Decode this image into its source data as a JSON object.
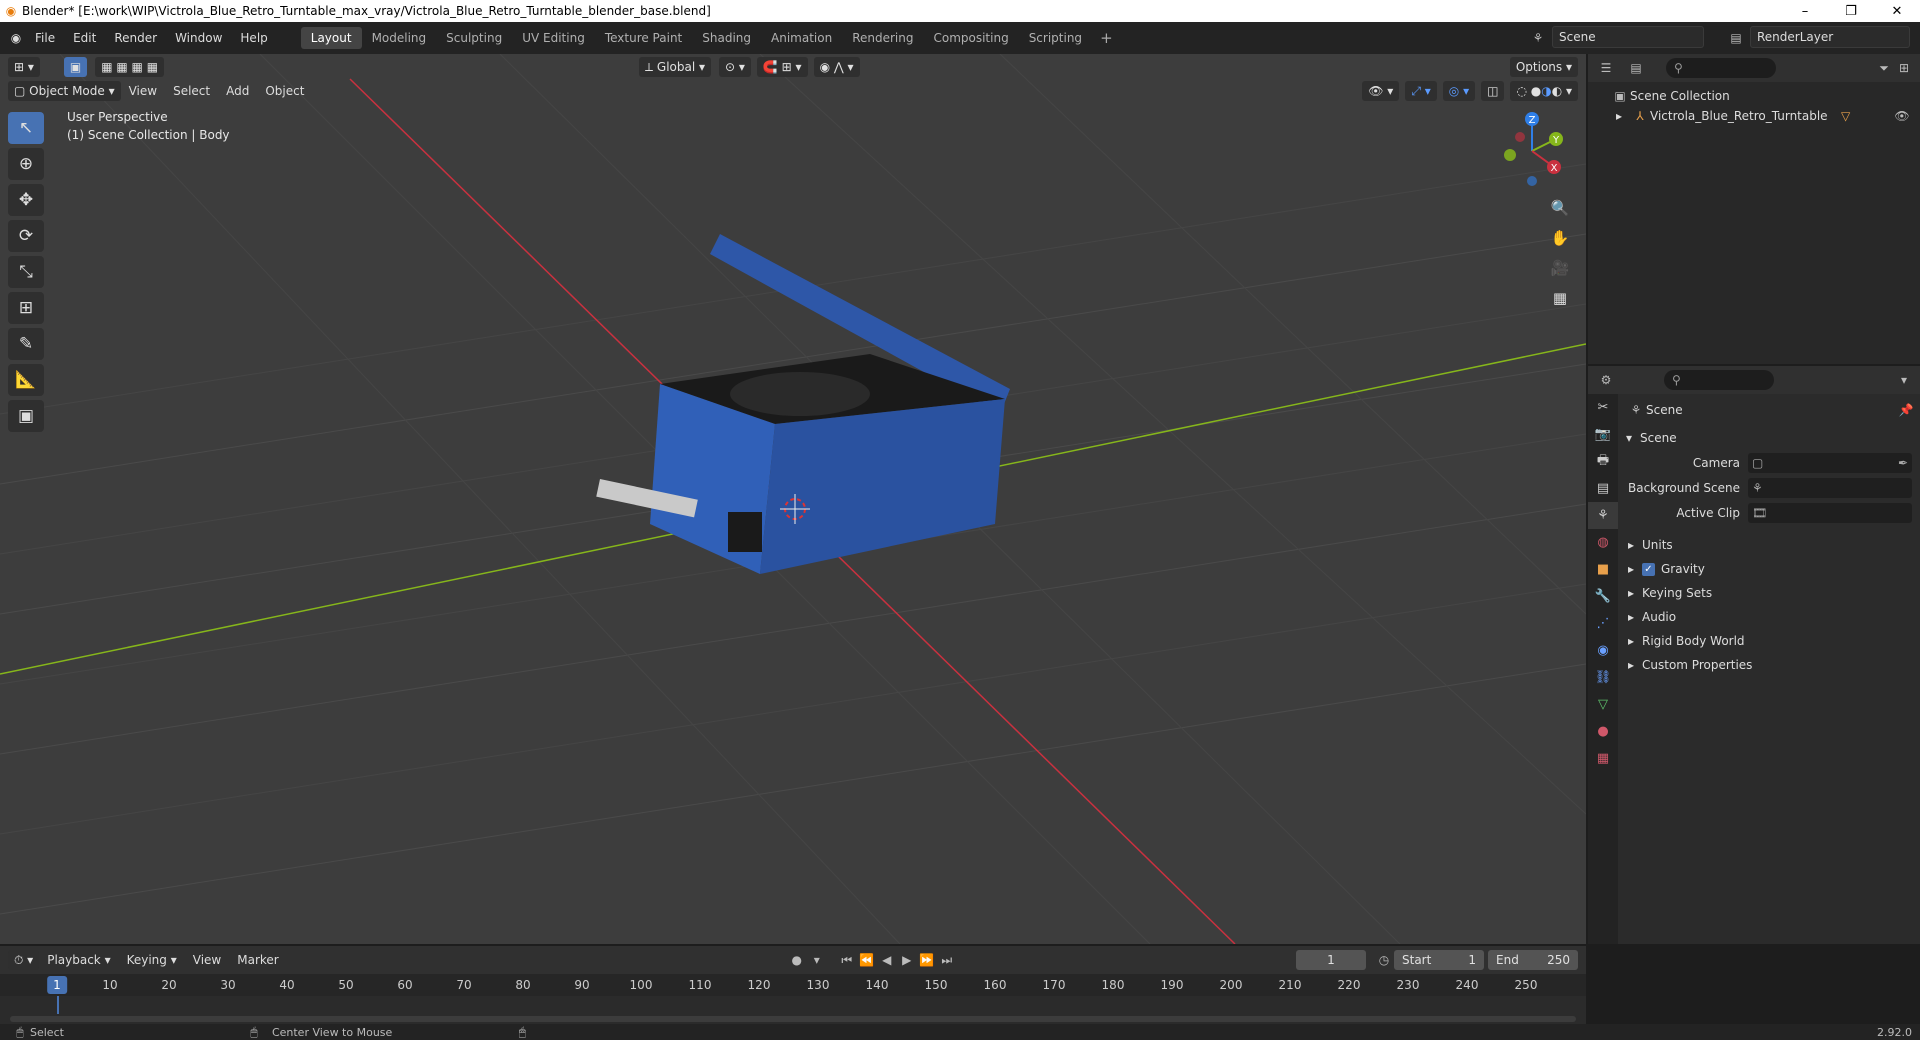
{
  "window": {
    "title": "Blender* [E:\\work\\WIP\\Victrola_Blue_Retro_Turntable_max_vray/Victrola_Blue_Retro_Turntable_blender_base.blend]",
    "minimize": "–",
    "restore": "❐",
    "close": "✕"
  },
  "menu": [
    "File",
    "Edit",
    "Render",
    "Window",
    "Help"
  ],
  "workspaces": [
    "Layout",
    "Modeling",
    "Sculpting",
    "UV Editing",
    "Texture Paint",
    "Shading",
    "Animation",
    "Rendering",
    "Compositing",
    "Scripting"
  ],
  "workspace_add": "+",
  "scene_name": "Scene",
  "view_layer": "RenderLayer",
  "viewport": {
    "mode": "Object Mode",
    "menus": [
      "View",
      "Select",
      "Add",
      "Object"
    ],
    "orientation": "Global",
    "options": "Options",
    "perspective": "User Perspective",
    "collection_info": "(1) Scene Collection | Body",
    "gizmo_axes": {
      "x": "X",
      "y": "Y",
      "z": "Z"
    }
  },
  "outliner": {
    "root": "Scene Collection",
    "items": [
      "Victrola_Blue_Retro_Turntable"
    ]
  },
  "properties": {
    "context": "Scene",
    "section": "Scene",
    "fields": [
      {
        "label": "Camera",
        "value": ""
      },
      {
        "label": "Background Scene",
        "value": ""
      },
      {
        "label": "Active Clip",
        "value": ""
      }
    ],
    "subsections": [
      "Units",
      "Gravity",
      "Keying Sets",
      "Audio",
      "Rigid Body World",
      "Custom Properties"
    ],
    "gravity_checked": true
  },
  "timeline": {
    "menus": [
      "Playback",
      "Keying",
      "View",
      "Marker"
    ],
    "current_frame": "1",
    "start_label": "Start",
    "start": "1",
    "end_label": "End",
    "end": "250",
    "ruler": [
      "10",
      "20",
      "30",
      "40",
      "50",
      "60",
      "70",
      "80",
      "90",
      "100",
      "110",
      "120",
      "130",
      "140",
      "150",
      "160",
      "170",
      "180",
      "190",
      "200",
      "210",
      "220",
      "230",
      "240",
      "250"
    ]
  },
  "status": {
    "left": "Select",
    "middle": "Center View to Mouse",
    "version": "2.92.0"
  },
  "colors": {
    "accent": "#4772b3",
    "x_axis": "#c9313f",
    "y_axis": "#86b61b",
    "z_axis": "#2f7fe8",
    "object_blue": "#2e57a8"
  }
}
